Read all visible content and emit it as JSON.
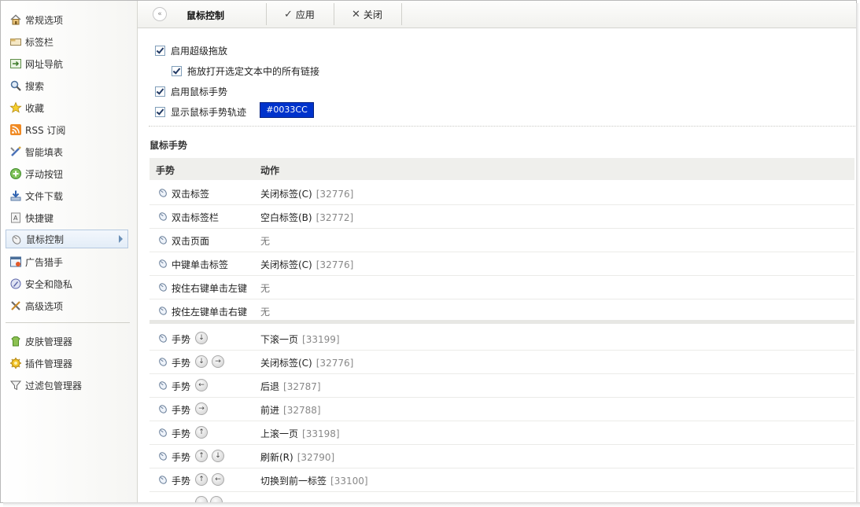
{
  "sidebar": {
    "items": [
      {
        "label": "常规选项",
        "icon": "home-icon"
      },
      {
        "label": "标签栏",
        "icon": "tabbar-icon"
      },
      {
        "label": "网址导航",
        "icon": "url-nav-icon"
      },
      {
        "label": "搜索",
        "icon": "search-icon"
      },
      {
        "label": "收藏",
        "icon": "star-icon"
      },
      {
        "label": "RSS 订阅",
        "icon": "rss-icon"
      },
      {
        "label": "智能填表",
        "icon": "form-fill-icon"
      },
      {
        "label": "浮动按钮",
        "icon": "floating-button-icon"
      },
      {
        "label": "文件下载",
        "icon": "download-icon"
      },
      {
        "label": "快捷键",
        "icon": "shortcut-icon"
      },
      {
        "label": "鼠标控制",
        "icon": "mouse-icon",
        "active": true
      },
      {
        "label": "广告猎手",
        "icon": "ad-hunter-icon"
      },
      {
        "label": "安全和隐私",
        "icon": "security-icon"
      },
      {
        "label": "高级选项",
        "icon": "tools-icon"
      }
    ],
    "managers": [
      {
        "label": "皮肤管理器",
        "icon": "skin-icon"
      },
      {
        "label": "插件管理器",
        "icon": "plugin-icon"
      },
      {
        "label": "过滤包管理器",
        "icon": "filter-icon"
      }
    ]
  },
  "toolbar": {
    "title": "鼠标控制",
    "apply_label": "应用",
    "close_label": "关闭"
  },
  "options": {
    "super_drag": "启用超级拖放",
    "drag_open_links": "拖放打开选定文本中的所有链接",
    "mouse_gesture": "启用鼠标手势",
    "show_trail": "显示鼠标手势轨迹",
    "trail_color": "#0033CC"
  },
  "section_title": "鼠标手势",
  "table": {
    "col_gesture": "手势",
    "col_action": "动作",
    "rows": [
      {
        "gesture": "双击标签",
        "action": "关闭标签(C)",
        "code": "[32776]"
      },
      {
        "gesture": "双击标签栏",
        "action": "空白标签(B)",
        "code": "[32772]"
      },
      {
        "gesture": "双击页面",
        "action": "无",
        "code": ""
      },
      {
        "gesture": "中键单击标签",
        "action": "关闭标签(C)",
        "code": "[32776]"
      },
      {
        "gesture": "按住右键单击左键",
        "action": "无",
        "code": ""
      },
      {
        "gesture": "按住左键单击右键",
        "action": "无",
        "code": ""
      }
    ],
    "gesture_rows": [
      {
        "gesture": "手势",
        "arrows": [
          "↓"
        ],
        "action": "下滚一页",
        "code": "[33199]"
      },
      {
        "gesture": "手势",
        "arrows": [
          "↓",
          "→"
        ],
        "action": "关闭标签(C)",
        "code": "[32776]"
      },
      {
        "gesture": "手势",
        "arrows": [
          "←"
        ],
        "action": "后退",
        "code": "[32787]"
      },
      {
        "gesture": "手势",
        "arrows": [
          "→"
        ],
        "action": "前进",
        "code": "[32788]"
      },
      {
        "gesture": "手势",
        "arrows": [
          "↑"
        ],
        "action": "上滚一页",
        "code": "[33198]"
      },
      {
        "gesture": "手势",
        "arrows": [
          "↑",
          "↓"
        ],
        "action": "刷新(R)",
        "code": "[32790]"
      },
      {
        "gesture": "手势",
        "arrows": [
          "↑",
          "←"
        ],
        "action": "切换到前一标签",
        "code": "[33100]"
      }
    ]
  }
}
